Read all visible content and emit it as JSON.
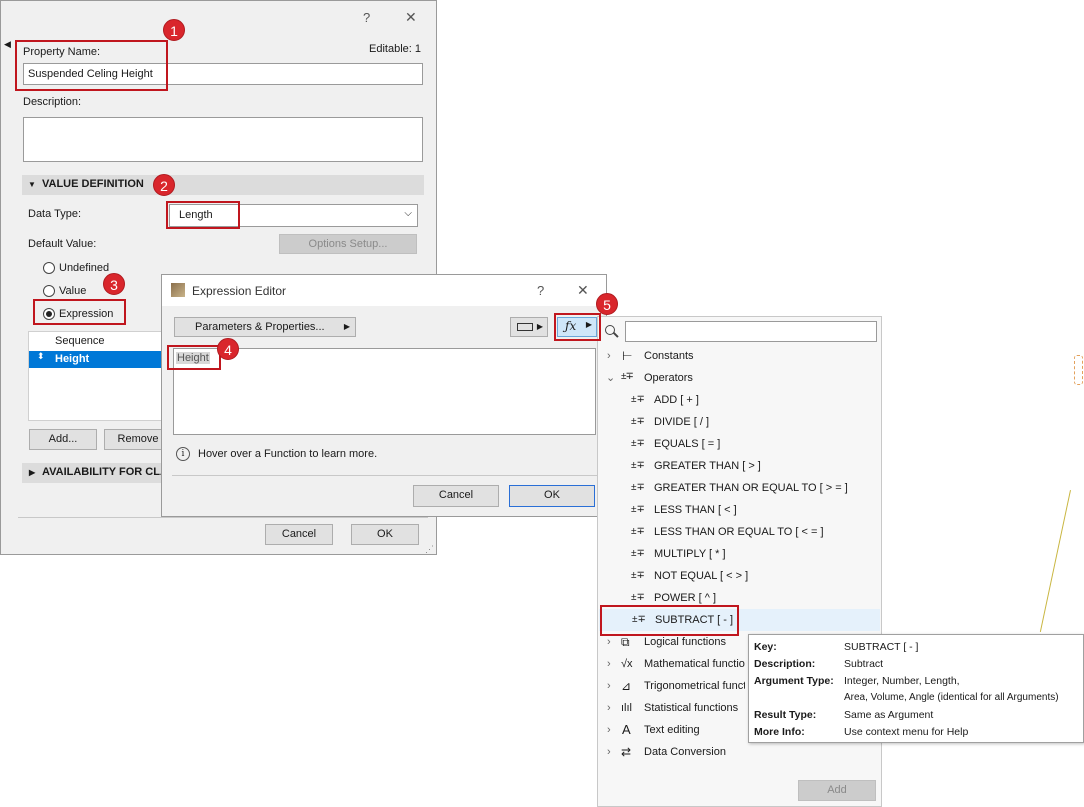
{
  "property_dialog": {
    "help_glyph": "?",
    "close_glyph": "✕",
    "property_name_label": "Property Name:",
    "editable_label": "Editable: 1",
    "property_name_value": "Suspended Celing Height",
    "description_label": "Description:",
    "description_value": "",
    "value_definition_header": "VALUE DEFINITION",
    "data_type_label": "Data Type:",
    "data_type_value": "Length",
    "default_value_label": "Default Value:",
    "options_setup_label": "Options Setup...",
    "radio_undefined": "Undefined",
    "radio_value": "Value",
    "radio_expression": "Expression",
    "sequence_header": "Sequence",
    "sequence_row": "Height",
    "add_button": "Add...",
    "remove_button": "Remove",
    "availability_header": "AVAILABILITY FOR CLASS",
    "cancel_button": "Cancel",
    "ok_button": "OK"
  },
  "expression_editor": {
    "title": "Expression Editor",
    "help_glyph": "?",
    "close_glyph": "✕",
    "params_button": "Parameters & Properties...",
    "expression_text": "Height",
    "hint": "Hover over a Function to learn more.",
    "cancel_button": "Cancel",
    "ok_button": "OK"
  },
  "function_panel": {
    "search_placeholder": "",
    "constants": "Constants",
    "operators": "Operators",
    "operator_items": [
      "ADD  [ + ]",
      "DIVIDE  [ / ]",
      "EQUALS  [ = ]",
      "GREATER THAN  [ > ]",
      "GREATER THAN OR EQUAL TO  [ > = ]",
      "LESS THAN  [ < ]",
      "LESS THAN OR EQUAL TO  [ < = ]",
      "MULTIPLY  [ * ]",
      "NOT EQUAL  [ < > ]",
      "POWER  [ ^ ]",
      "SUBTRACT  [ - ]"
    ],
    "categories": [
      "Logical functions",
      "Mathematical functions",
      "Trigonometrical functions",
      "Statistical functions",
      "Text editing",
      "Data Conversion"
    ],
    "add_button": "Add"
  },
  "tooltip": {
    "key_label": "Key:",
    "key_value": "SUBTRACT  [ - ]",
    "description_label": "Description:",
    "description_value": "Subtract",
    "argument_label": "Argument Type:",
    "argument_value_1": "Integer, Number, Length,",
    "argument_value_2": "Area, Volume, Angle (identical for all Arguments)",
    "result_label": "Result Type:",
    "result_value": "Same as Argument",
    "more_label": "More Info:",
    "more_value": "Use context menu for Help"
  },
  "badges": [
    "1",
    "2",
    "3",
    "4",
    "5"
  ],
  "colors": {
    "highlight": "#c0161e",
    "badge": "#d9262c",
    "selection": "#0078d7",
    "primary_border": "#2a6fd6"
  }
}
